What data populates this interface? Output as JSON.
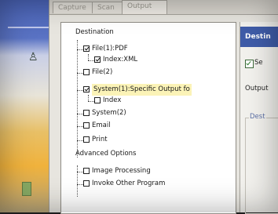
{
  "tabs": [
    "Capture",
    "Scan",
    "Output"
  ],
  "tree": {
    "destination_label": "Destination",
    "items": [
      {
        "label": "File(1):PDF",
        "checked": true
      },
      {
        "label": "Index:XML",
        "checked": true
      },
      {
        "label": "File(2)",
        "checked": false
      },
      {
        "label": "System(1):Specific Output fo",
        "checked": true
      },
      {
        "label": "Index",
        "checked": false
      },
      {
        "label": "System(2)",
        "checked": false
      },
      {
        "label": "Email",
        "checked": false
      },
      {
        "label": "Print",
        "checked": false
      }
    ],
    "advanced_label": "Advanced Options",
    "advanced_items": [
      {
        "label": "Image Processing",
        "checked": false
      },
      {
        "label": "Invoke Other Program",
        "checked": false
      }
    ]
  },
  "props": {
    "header": "Destin",
    "send_label": "Se",
    "output_label": "Output",
    "dest_group": "Dest"
  }
}
